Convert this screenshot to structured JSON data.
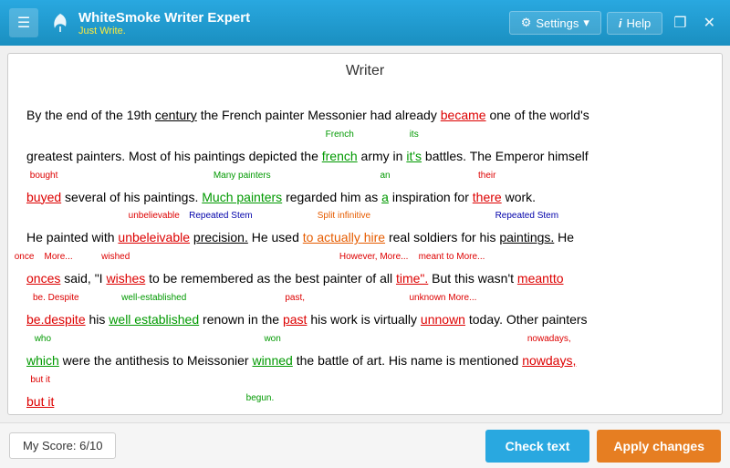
{
  "titleBar": {
    "brand": "WhiteSmoke Writer Expert",
    "tagline": "Just Write.",
    "menuIcon": "☰",
    "settings_label": "Settings",
    "help_label": "Help",
    "win_restore": "❐",
    "win_close": "✕"
  },
  "main": {
    "title": "Writer",
    "score_label": "My Score: 6/10"
  },
  "footer": {
    "check_label": "Check text",
    "apply_label": "Apply changes"
  }
}
